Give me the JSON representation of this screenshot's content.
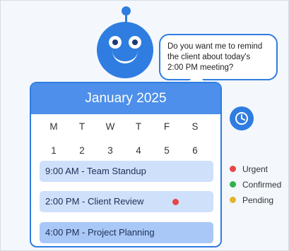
{
  "robot": {
    "icon": "robot-icon"
  },
  "bubble": {
    "message": "Do you want me to remind\nthe client about today's\n2:00 PM meeting?"
  },
  "calendar": {
    "month_label": "January 2025",
    "weekdays": [
      "M",
      "T",
      "W",
      "T",
      "F",
      "S"
    ],
    "dates": [
      "1",
      "2",
      "3",
      "4",
      "5",
      "6"
    ],
    "events": [
      {
        "label": "9:00 AM - Team Standup",
        "status": ""
      },
      {
        "label": "2:00 PM - Client Review",
        "status": "Urgent"
      },
      {
        "label": "4:00 PM - Project Planning",
        "status": ""
      }
    ]
  },
  "clock": {
    "icon": "clock-icon"
  },
  "legend": [
    {
      "label": "Urgent",
      "color": "#e84545"
    },
    {
      "label": "Confirmed",
      "color": "#2fb24a"
    },
    {
      "label": "Pending",
      "color": "#e3b22d"
    }
  ],
  "colors": {
    "primary": "#2f7de1",
    "header": "#4d8fea",
    "event": "#cfe0fb"
  }
}
